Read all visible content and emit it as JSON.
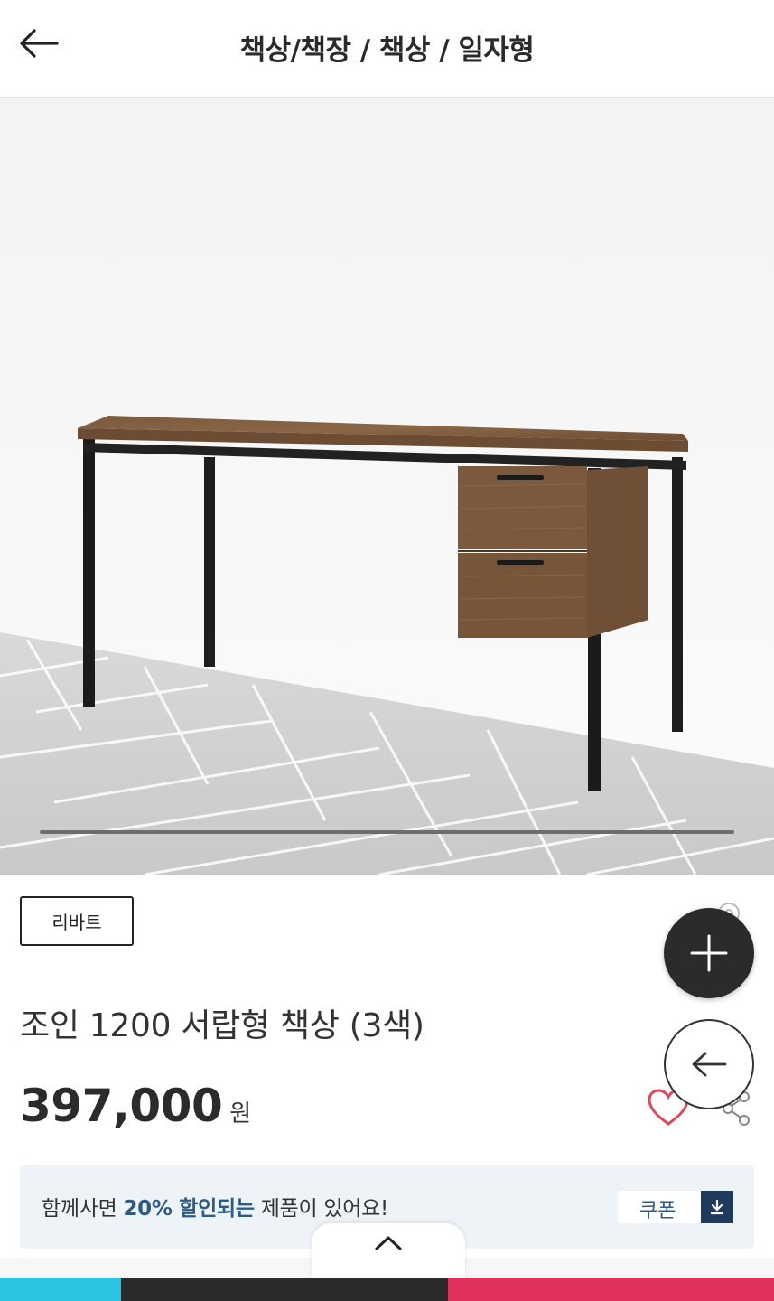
{
  "header": {
    "title": "책상/책장 / 책상 / 일자형"
  },
  "product": {
    "brand": "리바트",
    "name": "조인 1200 서랍형 책상 (3색)",
    "price": "397,000",
    "currency": "원",
    "image_alt": "조인 1200 서랍형 책상"
  },
  "promo": {
    "text_before": "함께사면 ",
    "highlight": "20% 할인되는",
    "text_after": " 제품이 있어요!",
    "coupon_label": "쿠폰"
  },
  "icons": {
    "back": "back-arrow-icon",
    "plus": "plus-icon",
    "float_back": "back-arrow-icon",
    "wishlist": "heart-icon",
    "share": "share-icon",
    "download": "download-icon",
    "expand": "chevron-up-icon"
  },
  "colors": {
    "fab_dark": "#2b2b2b",
    "promo_bg": "#eef3f8",
    "highlight": "#2d5b86",
    "heart": "#d94a5c",
    "strip": [
      "#2bc4e0",
      "#2a2a2a",
      "#e0325a"
    ]
  }
}
